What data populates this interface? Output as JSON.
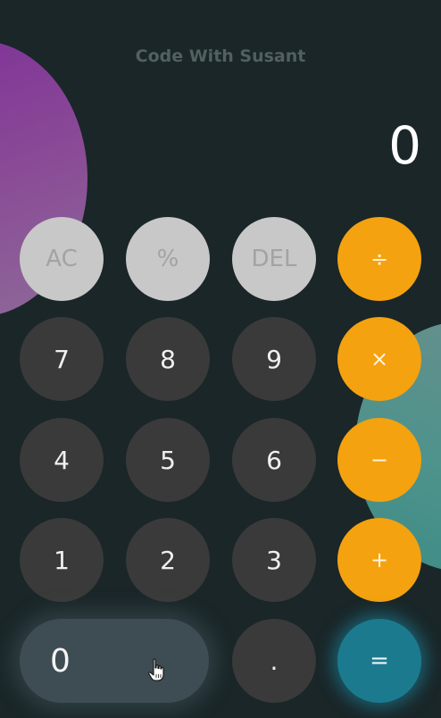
{
  "brand": "Code With Susant",
  "display": {
    "value": "0"
  },
  "keys": {
    "ac": "AC",
    "percent": "%",
    "del": "DEL",
    "divide": "÷",
    "seven": "7",
    "eight": "8",
    "nine": "9",
    "multiply": "×",
    "four": "4",
    "five": "5",
    "six": "6",
    "minus": "−",
    "one": "1",
    "two": "2",
    "three": "3",
    "plus": "+",
    "zero": "0",
    "dot": ".",
    "equals": "="
  },
  "colors": {
    "background": "#1a2628",
    "number_key": "#3a3a3a",
    "function_key": "#c8c8c8",
    "operator_key": "#f4a20f",
    "equals_key": "#1c7a8f"
  },
  "icons": {
    "pointer": "hand-pointer-icon"
  }
}
